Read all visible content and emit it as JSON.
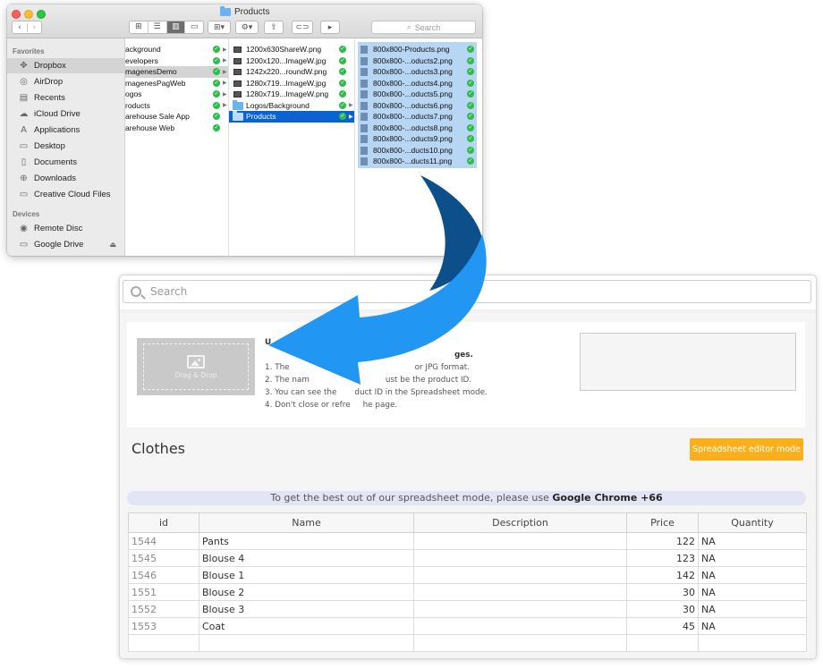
{
  "finder": {
    "title": "Products",
    "nav": {
      "back": "‹",
      "forward": "›"
    },
    "view_buttons": [
      "⊞",
      "☰",
      "▥",
      "▭"
    ],
    "search_placeholder": "Search",
    "sidebar": {
      "favorites_heading": "Favorites",
      "favorites": [
        {
          "label": "Dropbox",
          "icon": "dropbox-icon",
          "glyph": "✥",
          "selected": true
        },
        {
          "label": "AirDrop",
          "icon": "airdrop-icon",
          "glyph": "◎"
        },
        {
          "label": "Recents",
          "icon": "recents-icon",
          "glyph": "▤"
        },
        {
          "label": "iCloud Drive",
          "icon": "cloud-icon",
          "glyph": "☁"
        },
        {
          "label": "Applications",
          "icon": "applications-icon",
          "glyph": "A"
        },
        {
          "label": "Desktop",
          "icon": "desktop-icon",
          "glyph": "▭"
        },
        {
          "label": "Documents",
          "icon": "documents-icon",
          "glyph": "▯"
        },
        {
          "label": "Downloads",
          "icon": "downloads-icon",
          "glyph": "⊕"
        },
        {
          "label": "Creative Cloud Files",
          "icon": "folder-icon",
          "glyph": "▭"
        }
      ],
      "devices_heading": "Devices",
      "devices": [
        {
          "label": "Remote Disc",
          "icon": "disc-icon",
          "glyph": "◉"
        },
        {
          "label": "Google Drive",
          "icon": "drive-icon",
          "glyph": "▭",
          "eject": "⏏"
        }
      ]
    },
    "column1": [
      {
        "label": "ackground"
      },
      {
        "label": "evelopers"
      },
      {
        "label": "magenesDemo",
        "highlighted": true
      },
      {
        "label": "magenesPagWeb"
      },
      {
        "label": "ogos"
      },
      {
        "label": "roducts"
      },
      {
        "label": "arehouse Sale App",
        "no_arrow": true
      },
      {
        "label": "arehouse Web",
        "no_arrow": true
      }
    ],
    "column2": [
      {
        "label": "1200x630ShareW.png",
        "type": "image"
      },
      {
        "label": "1200x120...ImageW.jpg",
        "type": "image"
      },
      {
        "label": "1242x220...roundW.png",
        "type": "image"
      },
      {
        "label": "1280x719...ImageW.jpg",
        "type": "image"
      },
      {
        "label": "1280x719...ImageW.png",
        "type": "image"
      },
      {
        "label": "Logos/Background",
        "type": "folder"
      },
      {
        "label": "Products",
        "type": "folder",
        "selected": true
      }
    ],
    "column3": [
      "800x800-Products.png",
      "800x800-...oducts2.png",
      "800x800-...oducts3.png",
      "800x800-...oducts4.png",
      "800x800-...oducts5.png",
      "800x800-...oducts6.png",
      "800x800-...oducts7.png",
      "800x800-...oducts8.png",
      "800x800-...oducts9.png",
      "800x800-...ducts10.png",
      "800x800-...ducts11.png"
    ],
    "sync_glyph": "✓",
    "arrow_glyph": "▶"
  },
  "app": {
    "search_placeholder": "Search",
    "dropzone_label": "Drag & Drop",
    "instructions": {
      "title_fragment": "U",
      "line0": "ges.",
      "line1a": "1. The",
      "line1b": "or JPG format.",
      "line2a": "2. The nam",
      "line2b": "ust be the product ID.",
      "line3a": "3. You can see the",
      "line3b": "duct ID in the Spreadsheet mode.",
      "line4a": "4. Don't close or refre",
      "line4b": "he page."
    },
    "category_title": "Clothes",
    "mode_button": "Spreadsheet editor mode",
    "notice_text": "To get the best out of our spreadsheet mode, please use ",
    "notice_bold": "Google Chrome +66",
    "table": {
      "headers": [
        "id",
        "Name",
        "Description",
        "Price",
        "Quantity"
      ],
      "rows": [
        {
          "id": "1544",
          "name": "Pants",
          "description": "",
          "price": "122",
          "quantity": "NA"
        },
        {
          "id": "1545",
          "name": "Blouse 4",
          "description": "",
          "price": "123",
          "quantity": "NA"
        },
        {
          "id": "1546",
          "name": "Blouse 1",
          "description": "",
          "price": "142",
          "quantity": "NA"
        },
        {
          "id": "1551",
          "name": "Blouse 2",
          "description": "",
          "price": "30",
          "quantity": "NA"
        },
        {
          "id": "1552",
          "name": "Blouse 3",
          "description": "",
          "price": "30",
          "quantity": "NA"
        },
        {
          "id": "1553",
          "name": "Coat",
          "description": "",
          "price": "45",
          "quantity": "NA"
        },
        {
          "id": "",
          "name": "",
          "description": "",
          "price": "",
          "quantity": ""
        }
      ]
    }
  },
  "colors": {
    "finder_selection": "#0a63d0",
    "file_selection": "#b7d6f4",
    "sync_green": "#2ebd4a",
    "button_orange": "#fbb01b",
    "arrow_light": "#2196f3",
    "arrow_dark": "#0d4f8a"
  }
}
